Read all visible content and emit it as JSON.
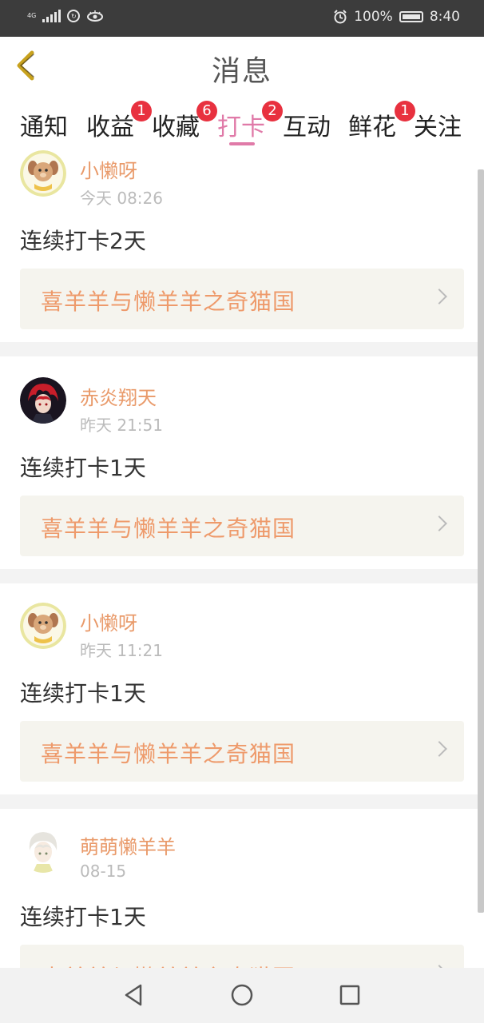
{
  "status": {
    "network": "4G",
    "battery": "100%",
    "time": "8:40"
  },
  "header": {
    "title": "消息"
  },
  "tabs": [
    {
      "label": "通知",
      "badge": null
    },
    {
      "label": "收益",
      "badge": "1"
    },
    {
      "label": "收藏",
      "badge": "6"
    },
    {
      "label": "打卡",
      "badge": "2",
      "active": true
    },
    {
      "label": "互动",
      "badge": null
    },
    {
      "label": "鲜花",
      "badge": "1"
    },
    {
      "label": "关注",
      "badge": null
    }
  ],
  "cards": [
    {
      "name": "小懒呀",
      "time": "今天 08:26",
      "text": "连续打卡2天",
      "link": "喜羊羊与懒羊羊之奇猫国",
      "avatar": "cartoon-dog-avatar"
    },
    {
      "name": "赤炎翔天",
      "time": "昨天 21:51",
      "text": "连续打卡1天",
      "link": "喜羊羊与懒羊羊之奇猫国",
      "avatar": "red-hair-character-avatar"
    },
    {
      "name": "小懒呀",
      "time": "昨天 11:21",
      "text": "连续打卡1天",
      "link": "喜羊羊与懒羊羊之奇猫国",
      "avatar": "cartoon-dog-avatar"
    },
    {
      "name": "萌萌懒羊羊",
      "time": "08-15",
      "text": "连续打卡1天",
      "link": "喜羊羊与懒羊羊之奇猫国",
      "avatar": "white-hair-character-avatar"
    }
  ],
  "colors": {
    "accent_pink": "#e07aa8",
    "badge_red": "#e8313f",
    "name_orange": "#e99a6a",
    "link_bg": "#f5f4ee"
  }
}
